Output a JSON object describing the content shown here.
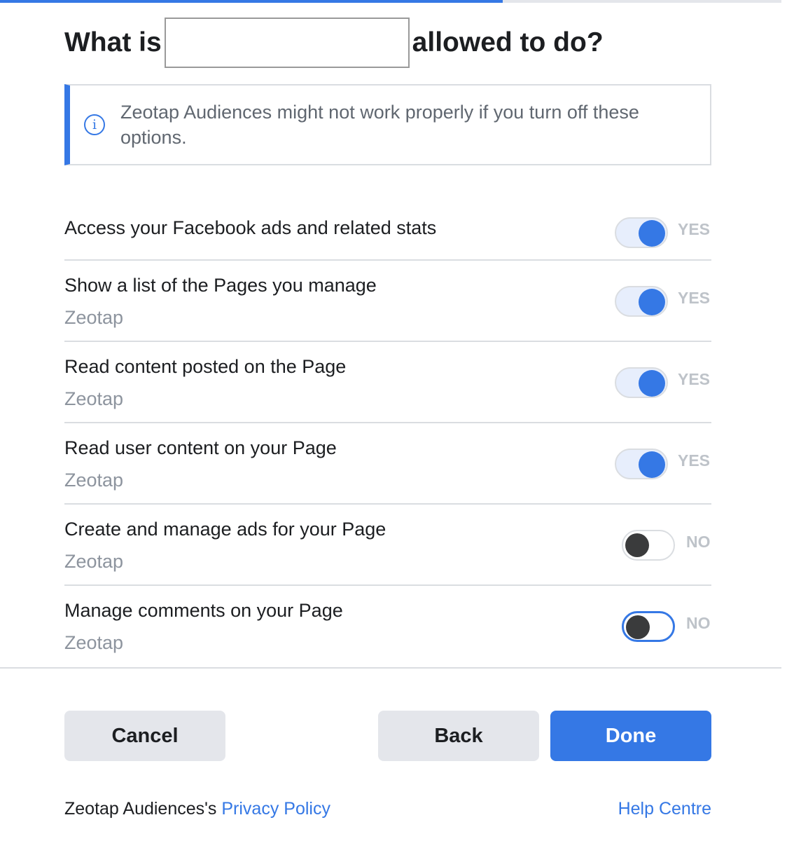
{
  "progress": {
    "fraction": 0.643
  },
  "dialog": {
    "title_prefix": "What is",
    "title_suffix": "allowed to do?",
    "notice": "Zeotap Audiences might not work properly if you turn off these options.",
    "notice_icon": "info-icon"
  },
  "permissions": [
    {
      "title": "Access your Facebook ads and related stats",
      "subtitle": "",
      "state": "YES",
      "enabled": true
    },
    {
      "title": "Show a list of the Pages you manage",
      "subtitle": "Zeotap",
      "state": "YES",
      "enabled": true
    },
    {
      "title": "Read content posted on the Page",
      "subtitle": "Zeotap",
      "state": "YES",
      "enabled": true
    },
    {
      "title": "Read user content on your Page",
      "subtitle": "Zeotap",
      "state": "YES",
      "enabled": true
    },
    {
      "title": "Create and manage ads for your Page",
      "subtitle": "Zeotap",
      "state": "NO",
      "enabled": false
    },
    {
      "title": "Manage comments on your Page",
      "subtitle": "Zeotap",
      "state": "NO",
      "enabled": false
    }
  ],
  "buttons": {
    "cancel": "Cancel",
    "back": "Back",
    "done": "Done"
  },
  "footer": {
    "privacy_prefix": "Zeotap Audiences's",
    "privacy_link": "Privacy Policy",
    "help_link": "Help Centre"
  },
  "colors": {
    "accent": "#3578e5",
    "button_grey": "#e4e6eb",
    "muted_text": "#8d949e",
    "toggle_label": "#bec3c9"
  }
}
